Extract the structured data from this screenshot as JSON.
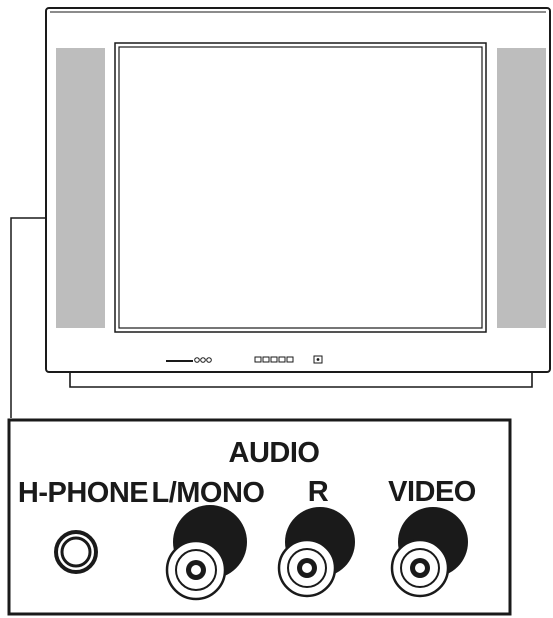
{
  "panel": {
    "group_label": "AUDIO",
    "jacks": [
      {
        "id": "hphone",
        "label": "H-PHONE"
      },
      {
        "id": "lmono",
        "label": "L/MONO"
      },
      {
        "id": "r",
        "label": "R"
      },
      {
        "id": "video",
        "label": "VIDEO"
      }
    ]
  },
  "colors": {
    "line": "#1a1a1a",
    "speaker_grille": "#bdbdbd",
    "background": "#ffffff"
  }
}
